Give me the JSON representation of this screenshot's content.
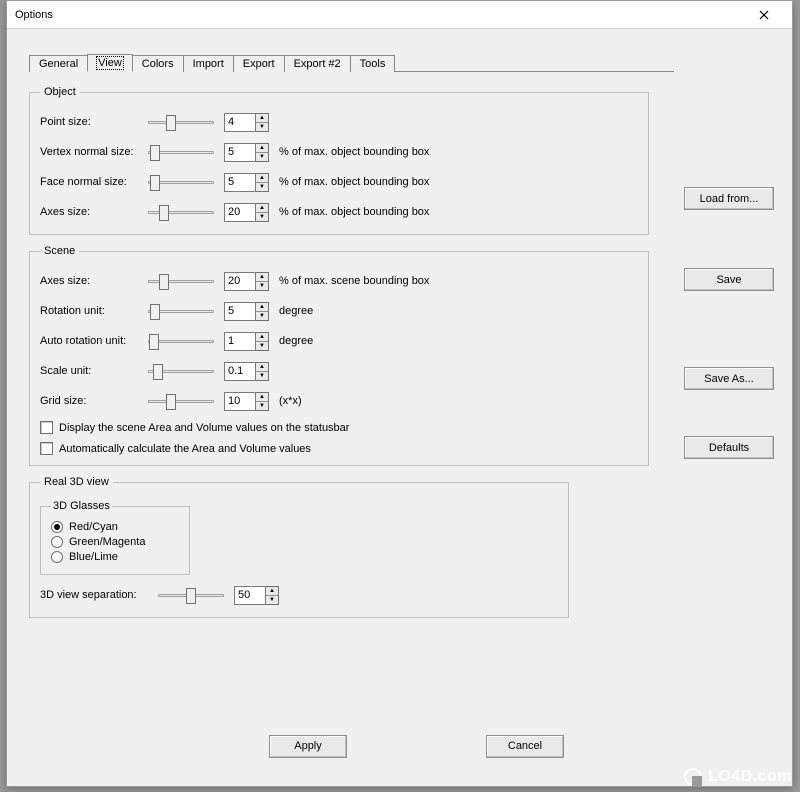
{
  "window": {
    "title": "Options"
  },
  "tabs": [
    "General",
    "View",
    "Colors",
    "Import",
    "Export",
    "Export #2",
    "Tools"
  ],
  "active_tab_index": 1,
  "object": {
    "legend": "Object",
    "rows": {
      "point_size": {
        "label": "Point size:",
        "value": "4",
        "slider": 0.3,
        "suffix": ""
      },
      "vertex_normal_size": {
        "label": "Vertex normal size:",
        "value": "5",
        "slider": 0.05,
        "suffix": "% of max. object bounding box"
      },
      "face_normal_size": {
        "label": "Face normal size:",
        "value": "5",
        "slider": 0.05,
        "suffix": "% of max. object bounding box"
      },
      "axes_size": {
        "label": "Axes size:",
        "value": "20",
        "slider": 0.2,
        "suffix": "% of max. object bounding box"
      }
    }
  },
  "scene": {
    "legend": "Scene",
    "rows": {
      "axes_size": {
        "label": "Axes size:",
        "value": "20",
        "slider": 0.2,
        "suffix": "% of max. scene bounding box"
      },
      "rotation": {
        "label": "Rotation unit:",
        "value": "5",
        "slider": 0.05,
        "suffix": "degree"
      },
      "auto_rotation": {
        "label": "Auto rotation unit:",
        "value": "1",
        "slider": 0.02,
        "suffix": "degree"
      },
      "scale_unit": {
        "label": "Scale unit:",
        "value": "0.1",
        "slider": 0.1,
        "suffix": ""
      },
      "grid_size": {
        "label": "Grid size:",
        "value": "10",
        "slider": 0.3,
        "suffix": "(x*x)"
      }
    },
    "chk_display": "Display the scene Area and Volume values on the statusbar",
    "chk_auto": "Automatically calculate the Area and Volume values"
  },
  "real3d": {
    "legend": "Real 3D view",
    "glasses_legend": "3D Glasses",
    "options": [
      "Red/Cyan",
      "Green/Magenta",
      "Blue/Lime"
    ],
    "selected_index": 0,
    "separation": {
      "label": "3D view separation:",
      "value": "50",
      "slider": 0.5
    }
  },
  "side_buttons": {
    "load_from": "Load from...",
    "save": "Save",
    "save_as": "Save As...",
    "defaults": "Defaults"
  },
  "footer": {
    "apply": "Apply",
    "cancel": "Cancel"
  },
  "watermark": "LO4D.com"
}
